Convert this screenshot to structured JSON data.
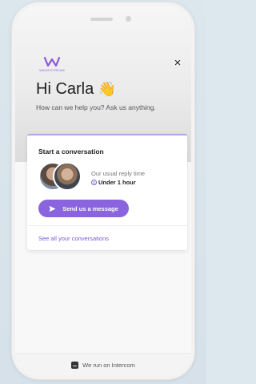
{
  "brand": {
    "name": "WAGESTREAM",
    "logo_icon": "wagestream-w-logo",
    "color": "#8a5ad6"
  },
  "header": {
    "greeting": "Hi Carla",
    "wave_emoji": "👋",
    "subtitle": "How can we help you? Ask us anything."
  },
  "conversation_card": {
    "title": "Start a conversation",
    "reply_label": "Our usual reply time",
    "reply_time": "Under 1 hour",
    "send_button_label": "Send us a message",
    "see_all_label": "See all your conversations",
    "accent_color": "#8a64de"
  },
  "footer": {
    "text": "We run on Intercom"
  }
}
